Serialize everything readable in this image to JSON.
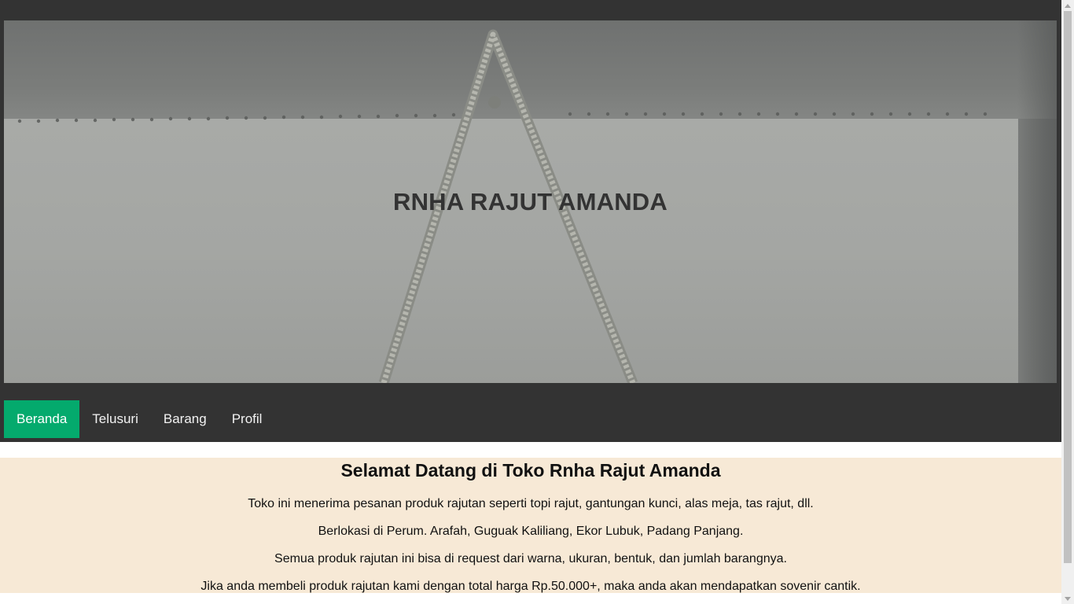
{
  "hero": {
    "title": "RNHA RAJUT AMANDA",
    "image_description_icon": "crochet-bag-photo"
  },
  "nav": {
    "items": [
      {
        "label": "Beranda",
        "active": true
      },
      {
        "label": "Telusuri",
        "active": false
      },
      {
        "label": "Barang",
        "active": false
      },
      {
        "label": "Profil",
        "active": false
      }
    ]
  },
  "content": {
    "heading": "Selamat Datang di Toko Rnha Rajut Amanda",
    "paragraphs": [
      "Toko ini menerima pesanan produk rajutan seperti topi rajut, gantungan kunci, alas meja, tas rajut, dll.",
      "Berlokasi di Perum. Arafah, Guguak Kaliliang, Ekor Lubuk, Padang Panjang.",
      "Semua produk rajutan ini bisa di request dari warna, ukuran, bentuk, dan jumlah barangnya.",
      "Jika anda membeli produk rajutan kami dengan total harga Rp.50.000+, maka anda akan mendapatkan sovenir cantik."
    ]
  },
  "colors": {
    "header_bg": "#333333",
    "nav_active": "#04aa6d",
    "content_bg": "#f7e9d6"
  }
}
